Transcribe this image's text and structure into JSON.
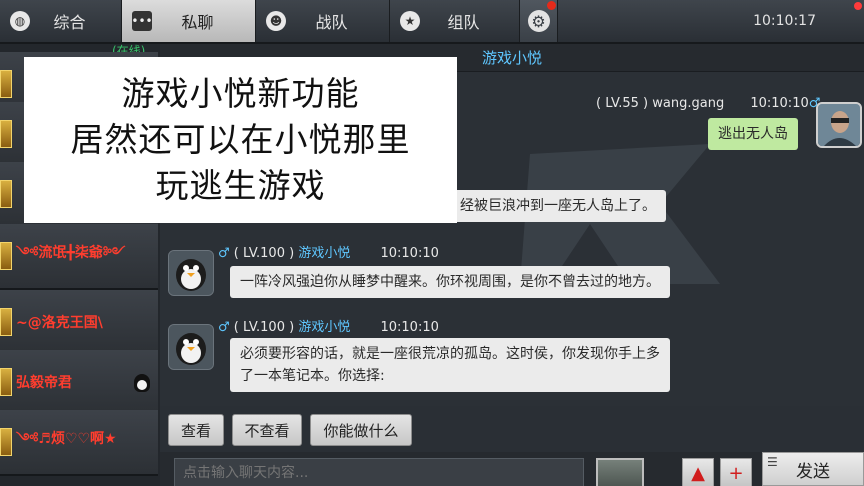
{
  "tabs": [
    {
      "label": "综合",
      "icon": "globe-icon",
      "active": false
    },
    {
      "label": "私聊",
      "icon": "chat-bubble-icon",
      "active": true
    },
    {
      "label": "战队",
      "icon": "team-icon",
      "active": false
    },
    {
      "label": "组队",
      "icon": "star-badge-icon",
      "active": false
    }
  ],
  "settings_icon": "gear-icon",
  "clock": "10:10:17",
  "sidebar": {
    "online_label": "(在线)",
    "friends": [
      {
        "name": "",
        "qq": false
      },
      {
        "name": "",
        "qq": false
      },
      {
        "name": "",
        "qq": false
      },
      {
        "name": "༺流氓╋柒爺༻",
        "qq": false
      },
      {
        "name": "~@洛克王国\\",
        "qq": false
      },
      {
        "name": "弘毅帝君",
        "qq": true
      },
      {
        "name": "༺♬烦♡♡啊★",
        "qq": false
      }
    ]
  },
  "chat": {
    "title": "游戏小悦",
    "me": {
      "level": "( LV.55 )",
      "name": "wang.gang",
      "time": "10:10:10",
      "message": "逃出无人岛"
    },
    "bot_partial_message": "经被巨浪冲到一座无人岛上了。",
    "bot_messages": [
      {
        "level": "( LV.100 )",
        "name": "游戏小悦",
        "time": "10:10:10",
        "text": "一阵冷风强迫你从睡梦中醒来。你环视周围，是你不曾去过的地方。"
      },
      {
        "level": "( LV.100 )",
        "name": "游戏小悦",
        "time": "10:10:10",
        "text_line1": "必须要形容的话，就是一座很荒凉的孤岛。这时侯，你发现你手上多",
        "text_line2": "了一本笔记本。你选择:"
      }
    ]
  },
  "quick_replies": [
    "查看",
    "不查看",
    "你能做什么"
  ],
  "input": {
    "placeholder": "点击输入聊天内容...",
    "up_label": "▲",
    "plus_label": "+",
    "send_label": "发送"
  },
  "overlay": {
    "line1": "游戏小悦新功能",
    "line2": "居然还可以在小悦那里",
    "line3": "玩逃生游戏"
  },
  "colors": {
    "accent_blue": "#5fc7ff",
    "friend_red": "#ff3d2e",
    "my_bubble": "#bfe9a0",
    "online_green": "#38c46a"
  }
}
